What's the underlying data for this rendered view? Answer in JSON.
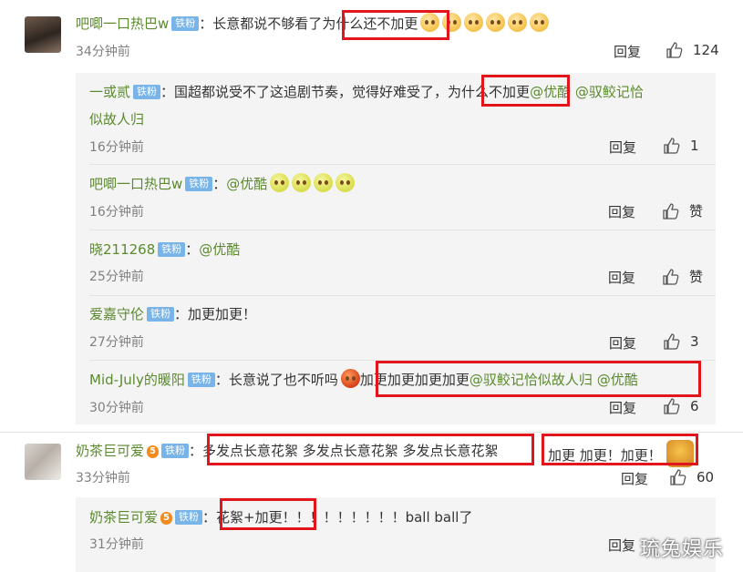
{
  "comments": [
    {
      "user": "吧唧一口热巴w",
      "badge": "铁粉",
      "colon": "：",
      "text_a": "长意都说不够看了",
      "text_b": "为什么还不加更",
      "time": "34分钟前",
      "reply": "回复",
      "likes": "124",
      "emoji_icon": "pleading-face-emoji"
    },
    {
      "user": "奶茶巨可爱",
      "level": "5",
      "badge": "铁粉",
      "colon": "：",
      "text_a": "多发点长意花絮 多发点长意花絮 多发点长意花絮",
      "text_b": "加更 加更！加更！",
      "time": "33分钟前",
      "reply": "回复",
      "likes": "60",
      "emoji_icon": "eating-face-emoji"
    }
  ],
  "replies": [
    {
      "user": "一或贰",
      "badge": "铁粉",
      "colon": "：",
      "text_a": "国超都说受不了这追剧节奏，觉得好难受了，",
      "text_b": "为什么不加更",
      "mention1": "@优酷",
      "mention2": "@驭鲛记恰",
      "mention3": "似故人归",
      "time": "16分钟前",
      "reply": "回复",
      "likes": "1"
    },
    {
      "user": "吧唧一口热巴w",
      "badge": "铁粉",
      "colon": "：",
      "mention1": "@优酷",
      "time": "16分钟前",
      "reply": "回复",
      "likes": "赞"
    },
    {
      "user": "晓211268",
      "badge": "铁粉",
      "colon": "：",
      "mention1": "@优酷",
      "time": "25分钟前",
      "reply": "回复",
      "likes": "赞"
    },
    {
      "user": "爱嘉守伦",
      "badge": "铁粉",
      "colon": "：",
      "text_a": "加更加更！",
      "time": "27分钟前",
      "reply": "回复",
      "likes": "3"
    },
    {
      "user": "Mid-July的暖阳",
      "badge": "铁粉",
      "colon": "：",
      "text_a": "长意说了也不听吗",
      "text_b": "加更加更加更加更",
      "mention1": "@驭鲛记恰似故人归",
      "mention2": "@优酷",
      "time": "30分钟前",
      "reply": "回复",
      "likes": "6"
    },
    {
      "user": "奶茶巨可爱",
      "level": "5",
      "badge": "铁粉",
      "colon": "：",
      "text_a": "花絮+加更！",
      "text_b": "！！！！！！！！ball ball了",
      "time": "31分钟前",
      "reply": "回复"
    }
  ],
  "watermark": "琉兔娱乐",
  "colors": {
    "username": "#5b8a2e",
    "badge": "#78b4e8",
    "highlight_box": "#e2141c",
    "reply_bg": "#f4f4f4"
  }
}
